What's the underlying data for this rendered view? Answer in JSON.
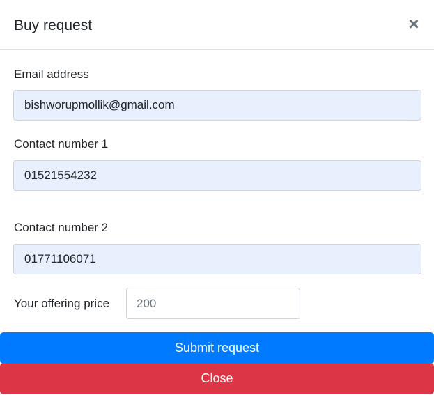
{
  "modal": {
    "title": "Buy request",
    "close_icon": "×"
  },
  "form": {
    "email": {
      "label": "Email address",
      "value": "bishworupmollik@gmail.com"
    },
    "contact1": {
      "label": "Contact number 1",
      "value": "01521554232"
    },
    "contact2": {
      "label": "Contact number 2",
      "value": "01771106071"
    },
    "price": {
      "label": "Your offering price",
      "placeholder": "200"
    }
  },
  "actions": {
    "submit_label": "Submit request",
    "close_label": "Close"
  },
  "colors": {
    "primary": "#007bff",
    "danger": "#dc3545",
    "autofill_bg": "#e8f0fe"
  }
}
